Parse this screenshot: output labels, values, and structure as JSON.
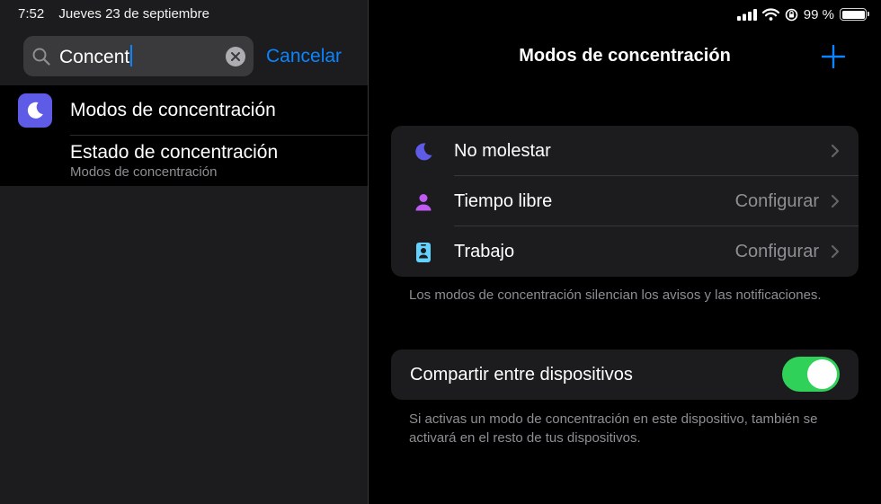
{
  "status_bar": {
    "time": "7:52",
    "date": "Jueves 23 de septiembre",
    "battery_text": "99 %"
  },
  "search": {
    "query": "Concent",
    "cancel_label": "Cancelar"
  },
  "results": [
    {
      "title": "Modos de concentración",
      "icon": "moon-icon"
    },
    {
      "title": "Estado de concentración",
      "subtitle": "Modos de concentración"
    }
  ],
  "detail": {
    "title": "Modos de concentración",
    "modes": [
      {
        "label": "No molestar",
        "value": "",
        "icon": "moon-icon",
        "color": "#5e5ce6"
      },
      {
        "label": "Tiempo libre",
        "value": "Configurar",
        "icon": "person-icon",
        "color": "#bf5af2"
      },
      {
        "label": "Trabajo",
        "value": "Configurar",
        "icon": "id-badge-icon",
        "color": "#64d2ff"
      }
    ],
    "modes_footer": "Los modos de concentración silencian los avisos y las notificaciones.",
    "share": {
      "label": "Compartir entre dispositivos",
      "enabled": true
    },
    "share_footer": "Si activas un modo de concentración en este dispositivo, también se activará en el resto de tus dispositivos."
  },
  "colors": {
    "accent": "#0a84ff",
    "toggle_on": "#30d158",
    "group_background": "#1c1c1e"
  }
}
